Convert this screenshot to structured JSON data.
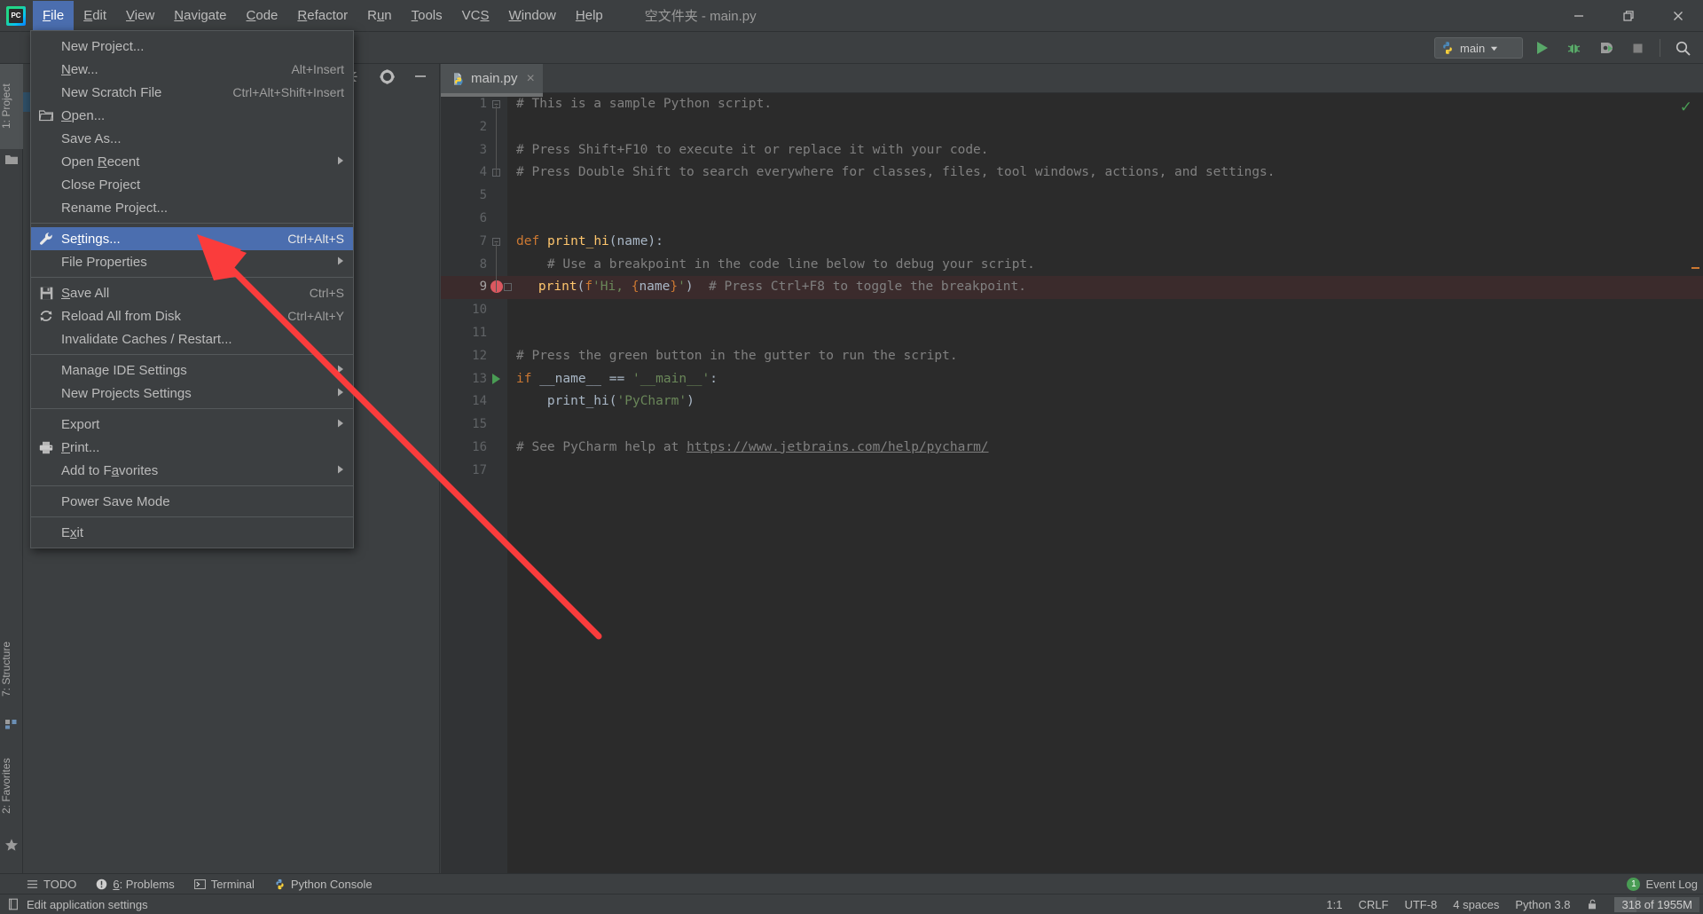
{
  "app": {
    "window_title": "空文件夹 - main.py",
    "logo": "pycharm-logo"
  },
  "menubar": {
    "items": [
      {
        "label": "File",
        "mnemonic": "F",
        "active": true
      },
      {
        "label": "Edit",
        "mnemonic": "E",
        "active": false
      },
      {
        "label": "View",
        "mnemonic": "V",
        "active": false
      },
      {
        "label": "Navigate",
        "mnemonic": "N",
        "active": false
      },
      {
        "label": "Code",
        "mnemonic": "C",
        "active": false
      },
      {
        "label": "Refactor",
        "mnemonic": "R",
        "active": false
      },
      {
        "label": "Run",
        "mnemonic": "u",
        "active": false
      },
      {
        "label": "Tools",
        "mnemonic": "T",
        "active": false
      },
      {
        "label": "VCS",
        "mnemonic": "S",
        "active": false
      },
      {
        "label": "Window",
        "mnemonic": "W",
        "active": false
      },
      {
        "label": "Help",
        "mnemonic": "H",
        "active": false
      }
    ],
    "window_controls": [
      "minimize-button",
      "restore-button",
      "close-button"
    ]
  },
  "file_menu": {
    "groups": [
      [
        {
          "label": "New Project...",
          "shortcut": "",
          "icon": "",
          "submenu": false,
          "selected": false,
          "mnemonic": ""
        },
        {
          "label": "New...",
          "shortcut": "Alt+Insert",
          "icon": "",
          "submenu": false,
          "selected": false,
          "mnemonic": "N"
        },
        {
          "label": "New Scratch File",
          "shortcut": "Ctrl+Alt+Shift+Insert",
          "icon": "",
          "submenu": false,
          "selected": false,
          "mnemonic": ""
        },
        {
          "label": "Open...",
          "shortcut": "",
          "icon": "folder-icon",
          "submenu": false,
          "selected": false,
          "mnemonic": "O"
        },
        {
          "label": "Save As...",
          "shortcut": "",
          "icon": "",
          "submenu": false,
          "selected": false,
          "mnemonic": ""
        },
        {
          "label": "Open Recent",
          "shortcut": "",
          "icon": "",
          "submenu": true,
          "selected": false,
          "mnemonic": "R"
        },
        {
          "label": "Close Project",
          "shortcut": "",
          "icon": "",
          "submenu": false,
          "selected": false,
          "mnemonic": ""
        },
        {
          "label": "Rename Project...",
          "shortcut": "",
          "icon": "",
          "submenu": false,
          "selected": false,
          "mnemonic": ""
        }
      ],
      [
        {
          "label": "Settings...",
          "shortcut": "Ctrl+Alt+S",
          "icon": "wrench-icon",
          "submenu": false,
          "selected": true,
          "mnemonic": "t"
        },
        {
          "label": "File Properties",
          "shortcut": "",
          "icon": "",
          "submenu": true,
          "selected": false,
          "mnemonic": ""
        }
      ],
      [
        {
          "label": "Save All",
          "shortcut": "Ctrl+S",
          "icon": "save-icon",
          "submenu": false,
          "selected": false,
          "mnemonic": "S"
        },
        {
          "label": "Reload All from Disk",
          "shortcut": "Ctrl+Alt+Y",
          "icon": "reload-icon",
          "submenu": false,
          "selected": false,
          "mnemonic": ""
        },
        {
          "label": "Invalidate Caches / Restart...",
          "shortcut": "",
          "icon": "",
          "submenu": false,
          "selected": false,
          "mnemonic": ""
        }
      ],
      [
        {
          "label": "Manage IDE Settings",
          "shortcut": "",
          "icon": "",
          "submenu": true,
          "selected": false,
          "mnemonic": ""
        },
        {
          "label": "New Projects Settings",
          "shortcut": "",
          "icon": "",
          "submenu": true,
          "selected": false,
          "mnemonic": ""
        }
      ],
      [
        {
          "label": "Export",
          "shortcut": "",
          "icon": "",
          "submenu": true,
          "selected": false,
          "mnemonic": ""
        },
        {
          "label": "Print...",
          "shortcut": "",
          "icon": "printer-icon",
          "submenu": false,
          "selected": false,
          "mnemonic": "P"
        },
        {
          "label": "Add to Favorites",
          "shortcut": "",
          "icon": "",
          "submenu": true,
          "selected": false,
          "mnemonic": "a"
        }
      ],
      [
        {
          "label": "Power Save Mode",
          "shortcut": "",
          "icon": "",
          "submenu": false,
          "selected": false,
          "mnemonic": ""
        }
      ],
      [
        {
          "label": "Exit",
          "shortcut": "",
          "icon": "",
          "submenu": false,
          "selected": false,
          "mnemonic": "x"
        }
      ]
    ]
  },
  "toolbar": {
    "run_config": "main",
    "run_config_icon": "python-run-config-icon",
    "buttons": [
      "run-button",
      "debug-button",
      "coverage-button",
      "stop-button",
      "search-everywhere-button"
    ]
  },
  "left_tool_strip": {
    "tabs": [
      {
        "label": "1: Project",
        "icon": "folder-icon",
        "selected": true
      },
      {
        "label": "7: Structure",
        "icon": "structure-icon",
        "selected": false
      },
      {
        "label": "2: Favorites",
        "icon": "star-icon",
        "selected": false
      }
    ]
  },
  "project_pane": {
    "header_icons": [
      "collapse-all-icon",
      "settings-gear-icon",
      "hide-icon"
    ]
  },
  "editor_tabs": [
    {
      "label": "main.py",
      "icon": "python-file-icon",
      "active": true,
      "closable": true
    }
  ],
  "editor": {
    "inspection_status": "ok",
    "lines": [
      {
        "n": 1,
        "text": "# This is a sample Python script.",
        "type": "comment",
        "fold": "open",
        "mark": ""
      },
      {
        "n": 2,
        "text": "",
        "type": "empty",
        "fold": "",
        "mark": ""
      },
      {
        "n": 3,
        "text": "# Press Shift+F10 to execute it or replace it with your code.",
        "type": "comment",
        "fold": "",
        "mark": ""
      },
      {
        "n": 4,
        "text": "# Press Double Shift to search everywhere for classes, files, tool windows, actions, and settings.",
        "type": "comment",
        "fold": "end",
        "mark": ""
      },
      {
        "n": 5,
        "text": "",
        "type": "empty",
        "fold": "",
        "mark": ""
      },
      {
        "n": 6,
        "text": "",
        "type": "empty",
        "fold": "",
        "mark": ""
      },
      {
        "n": 7,
        "text": "def print_hi(name):",
        "type": "def",
        "fold": "open",
        "mark": ""
      },
      {
        "n": 8,
        "text": "    # Use a breakpoint in the code line below to debug your script.",
        "type": "comment-indent",
        "fold": "",
        "mark": ""
      },
      {
        "n": 9,
        "text": "    print(f'Hi, {name}')  # Press Ctrl+F8 to toggle the breakpoint.",
        "type": "print-fstring",
        "fold": "end",
        "mark": "breakpoint"
      },
      {
        "n": 10,
        "text": "",
        "type": "empty",
        "fold": "",
        "mark": ""
      },
      {
        "n": 11,
        "text": "",
        "type": "empty",
        "fold": "",
        "mark": ""
      },
      {
        "n": 12,
        "text": "# Press the green button in the gutter to run the script.",
        "type": "comment",
        "fold": "",
        "mark": ""
      },
      {
        "n": 13,
        "text": "if __name__ == '__main__':",
        "type": "if-main",
        "fold": "",
        "mark": "run"
      },
      {
        "n": 14,
        "text": "    print_hi('PyCharm')",
        "type": "call",
        "fold": "",
        "mark": ""
      },
      {
        "n": 15,
        "text": "",
        "type": "empty",
        "fold": "",
        "mark": ""
      },
      {
        "n": 16,
        "text": "# See PyCharm help at https://www.jetbrains.com/help/pycharm/",
        "type": "comment-link",
        "fold": "",
        "mark": ""
      },
      {
        "n": 17,
        "text": "",
        "type": "empty",
        "fold": "",
        "mark": ""
      }
    ],
    "link_url": "https://www.jetbrains.com/help/pycharm/",
    "comment_prefix_16": "# See PyCharm help at "
  },
  "bottom_bar": {
    "buttons": [
      {
        "label": "TODO",
        "icon": "todo-icon",
        "mnemonic": ""
      },
      {
        "label": "6: Problems",
        "icon": "warning-icon",
        "mnemonic": "6"
      },
      {
        "label": "Terminal",
        "icon": "terminal-icon",
        "mnemonic": ""
      },
      {
        "label": "Python Console",
        "icon": "python-icon",
        "mnemonic": ""
      }
    ],
    "event_log": {
      "label": "Event Log",
      "badge": "1"
    }
  },
  "status_bar": {
    "message": "Edit application settings",
    "message_icon": "document-icon",
    "right": {
      "caret": "1:1",
      "line_separator": "CRLF",
      "encoding": "UTF-8",
      "indent": "4 spaces",
      "interpreter": "Python 3.8",
      "lock_icon": "unlocked-icon",
      "memory": "318 of 1955M"
    }
  },
  "annotation": {
    "type": "red-arrow",
    "color": "#fa3c3c",
    "points_to": "Settings..."
  },
  "colors": {
    "bg": "#3c3f41",
    "editor_bg": "#2b2b2b",
    "gutter_bg": "#313335",
    "accent_selection": "#4b6eaf",
    "breakpoint": "#db5860",
    "run_green": "#499c54",
    "highlight_line": "#3b2b2c"
  }
}
